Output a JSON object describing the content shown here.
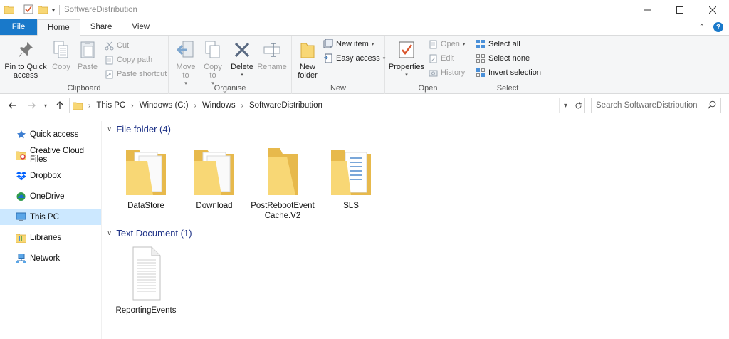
{
  "window": {
    "title": "SoftwareDistribution",
    "controls": [
      "minimize",
      "maximize",
      "close"
    ]
  },
  "ribbon_tabs": [
    "File",
    "Home",
    "Share",
    "View"
  ],
  "ribbon": {
    "clipboard": {
      "label": "Clipboard",
      "pin": "Pin to Quick access",
      "copy": "Copy",
      "paste": "Paste",
      "cut": "Cut",
      "copy_path": "Copy path",
      "paste_shortcut": "Paste shortcut"
    },
    "organise": {
      "label": "Organise",
      "move_to": "Move to",
      "copy_to": "Copy to",
      "delete": "Delete",
      "rename": "Rename"
    },
    "new": {
      "label": "New",
      "new_folder": "New folder",
      "new_item": "New item",
      "easy_access": "Easy access"
    },
    "open": {
      "label": "Open",
      "properties": "Properties",
      "open": "Open",
      "edit": "Edit",
      "history": "History"
    },
    "select": {
      "label": "Select",
      "select_all": "Select all",
      "select_none": "Select none",
      "invert_selection": "Invert selection"
    }
  },
  "address": {
    "breadcrumbs": [
      "This PC",
      "Windows (C:)",
      "Windows",
      "SoftwareDistribution"
    ],
    "search_placeholder": "Search SoftwareDistribution"
  },
  "nav_pane": [
    {
      "label": "Quick access",
      "icon": "star-icon"
    },
    {
      "label": "Creative Cloud Files",
      "icon": "creative-cloud-icon"
    },
    {
      "label": "Dropbox",
      "icon": "dropbox-icon"
    },
    {
      "label": "OneDrive",
      "icon": "onedrive-icon"
    },
    {
      "label": "This PC",
      "icon": "computer-icon",
      "selected": true
    },
    {
      "label": "Libraries",
      "icon": "libraries-icon"
    },
    {
      "label": "Network",
      "icon": "network-icon"
    }
  ],
  "groups": [
    {
      "header": "File folder (4)",
      "items": [
        {
          "name": "DataStore",
          "icon": "folder-with-files-icon"
        },
        {
          "name": "Download",
          "icon": "folder-with-files-icon"
        },
        {
          "name": "PostRebootEvent\nCache.V2",
          "icon": "empty-folder-icon"
        },
        {
          "name": "SLS",
          "icon": "folder-with-document-icon"
        }
      ]
    },
    {
      "header": "Text Document (1)",
      "items": [
        {
          "name": "ReportingEvents",
          "icon": "text-document-icon"
        }
      ]
    }
  ],
  "colors": {
    "file_tab": "#1979ca",
    "selected": "#cce8ff",
    "group_header": "#1e3287",
    "folder": "#f8d775"
  }
}
